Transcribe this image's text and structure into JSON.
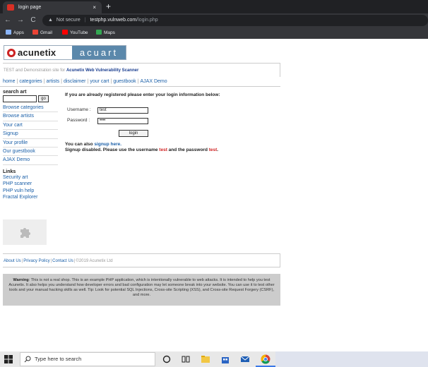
{
  "browser": {
    "tab_title": "login page",
    "tab_close": "×",
    "new_tab": "+",
    "back": "←",
    "forward": "→",
    "reload": "C",
    "not_secure": "Not secure",
    "url_host": "testphp.vulnweb.com",
    "url_path": "/login.php",
    "bookmarks": [
      "Apps",
      "Gmail",
      "YouTube",
      "Maps"
    ]
  },
  "logo": {
    "left": "acunetix",
    "right": "acuart"
  },
  "tagline": {
    "prefix": "TEST and Demonstration site for ",
    "link": "Acunetix Web Vulnerability Scanner"
  },
  "menu": [
    "home",
    "categories",
    "artists",
    "disclaimer",
    "your cart",
    "guestbook",
    "AJAX Demo"
  ],
  "sidebar": {
    "search_title": "search art",
    "go_label": "go",
    "links": [
      "Browse categories",
      "Browse artists",
      "Your cart",
      "Signup",
      "Your profile",
      "Our guestbook",
      "AJAX Demo"
    ],
    "links_title": "Links",
    "external_links": [
      "Security art",
      "PHP scanner",
      "PHP vuln help",
      "Fractal Explorer"
    ]
  },
  "login": {
    "intro": "If you are already registered please enter your login information below:",
    "username_label": "Username :",
    "username_value": "test",
    "password_label": "Password :",
    "password_value": "••••",
    "button": "login",
    "signup_prefix": "You can also ",
    "signup_link": "signup here.",
    "disabled_prefix": "Signup disabled. Please use the username ",
    "disabled_user": "test",
    "disabled_mid": " and the password ",
    "disabled_pass": "test",
    "disabled_end": "."
  },
  "footer": {
    "about": "About Us",
    "privacy": "Privacy Policy",
    "contact": "Contact Us",
    "copyright": "©2019 Acunetix Ltd"
  },
  "warning": {
    "label": "Warning",
    "text": ": This is not a real shop. This is an example PHP application, which is intentionally vulnerable to web attacks. It is intended to help you test Acunetix. It also helps you understand how developer errors and bad configuration may let someone break into your website. You can use it to test other tools and your manual hacking skills as well. Tip: Look for potential SQL Injections, Cross-site Scripting (XSS), and Cross-site Request Forgery (CSRF), and more."
  },
  "taskbar": {
    "search_placeholder": "Type here to search"
  }
}
